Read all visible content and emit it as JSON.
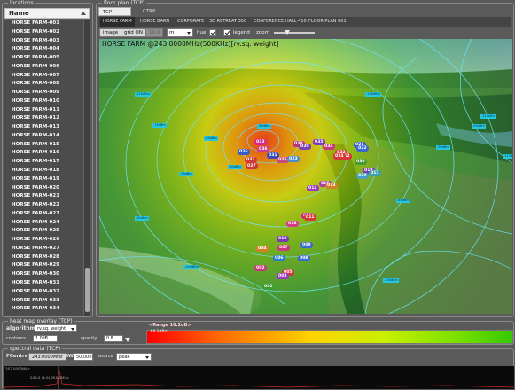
{
  "locations": {
    "title": "locations",
    "column_header": "Name",
    "items": [
      "HORSE FARM-001",
      "HORSE FARM-002",
      "HORSE FARM-003",
      "HORSE FARM-004",
      "HORSE FARM-005",
      "HORSE FARM-006",
      "HORSE FARM-007",
      "HORSE FARM-008",
      "HORSE FARM-009",
      "HORSE FARM-010",
      "HORSE FARM-011",
      "HORSE FARM-012",
      "HORSE FARM-013",
      "HORSE FARM-014",
      "HORSE FARM-015",
      "HORSE FARM-016",
      "HORSE FARM-017",
      "HORSE FARM-018",
      "HORSE FARM-019",
      "HORSE FARM-020",
      "HORSE FARM-021",
      "HORSE FARM-022",
      "HORSE FARM-023",
      "HORSE FARM-024",
      "HORSE FARM-025",
      "HORSE FARM-026",
      "HORSE FARM-027",
      "HORSE FARM-028",
      "HORSE FARM-029",
      "HORSE FARM-030",
      "HORSE FARM-031",
      "HORSE FARM-032",
      "HORSE FARM-033",
      "HORSE FARM-034"
    ]
  },
  "floor_plan": {
    "title": "floor plan (TCP)",
    "view_tabs": [
      "TCP settings...",
      "CTRP chart"
    ],
    "site_tabs": [
      "HORSE FARM",
      "HORSE BARN",
      "CORPORATE",
      "3D RETREAT 300",
      "CONFERENCE HALL 410",
      "FLOOR PLAN 001"
    ],
    "toolbar": {
      "image_label": "image",
      "grid_label": "grid ON",
      "dim_value": "10.0",
      "unit_value": "m",
      "hue_label": "hue",
      "legend_label": "legend",
      "zoom_label": "zoom"
    },
    "map_caption": "HORSE FARM @243.0000MHz(500KHz)[rv.sq. weight]",
    "access_points": [
      {
        "id": "033",
        "color": "#d6288c"
      },
      {
        "id": "028",
        "color": "#c0327c"
      },
      {
        "id": "026",
        "color": "#3a5cc8"
      },
      {
        "id": "036",
        "color": "#d03c8a"
      },
      {
        "id": "020",
        "color": "#7a3fb0"
      },
      {
        "id": "035",
        "color": "#7b3ab8"
      },
      {
        "id": "034",
        "color": "#c8387c"
      },
      {
        "id": "021",
        "color": "#3c5fc0"
      },
      {
        "id": "037",
        "color": "#d23a38"
      },
      {
        "id": "031",
        "color": "#3a4ab8"
      },
      {
        "id": "027",
        "color": "#c83a3a"
      },
      {
        "id": "025",
        "color": "#c84a7a"
      },
      {
        "id": "023",
        "color": "#4a8ad0"
      },
      {
        "id": "032",
        "color": "#e04040"
      },
      {
        "id": "012",
        "color": "#d23a3a"
      },
      {
        "id": "030",
        "color": "#4a9a30"
      },
      {
        "id": "019",
        "color": "#7a3ab0"
      },
      {
        "id": "029",
        "color": "#48a0b8"
      },
      {
        "id": "017",
        "color": "#3aa0b0"
      },
      {
        "id": "018",
        "color": "#d83a8a"
      },
      {
        "id": "016",
        "color": "#c8287c"
      },
      {
        "id": "014",
        "color": "#9a3ac0"
      },
      {
        "id": "015",
        "color": "#b03ab0"
      },
      {
        "id": "013",
        "color": "#d0802a"
      },
      {
        "id": "011",
        "color": "#d23a3a"
      },
      {
        "id": "010",
        "color": "#7a3ab0"
      },
      {
        "id": "009",
        "color": "#3a6ad0"
      },
      {
        "id": "007",
        "color": "#c8387c"
      },
      {
        "id": "004",
        "color": "#d0802a"
      },
      {
        "id": "006",
        "color": "#2a80c8"
      },
      {
        "id": "008",
        "color": "#3a6ad0"
      },
      {
        "id": "005",
        "color": "#d23a3a"
      },
      {
        "id": "002",
        "color": "#c8387c"
      },
      {
        "id": "003",
        "color": "#9a3ac0"
      },
      {
        "id": "001",
        "color": "#3aa030"
      },
      {
        "id": "022",
        "color": "#3a6ad0"
      },
      {
        "id": "024",
        "color": "#d23a3a"
      }
    ],
    "contour_labels": [
      "-54dBm",
      "-60dBm",
      "-65dBm",
      "-70dBm",
      "-75dBm",
      "-80dBm",
      "-85dBm",
      "-90dBm",
      "-95dBm",
      "-100dBm",
      "-105dBm",
      "-110dBm",
      "-115dBm",
      "-120dBm",
      "-125dBm"
    ]
  },
  "heat_overlay": {
    "title": "heat map overlay (TCP)",
    "algorithm_label": "algorithm",
    "algorithm_value": "rv.sq. weight",
    "contours_label": "contours",
    "contours_value": "1.0dB",
    "opacity_label": "opacity",
    "opacity_value": "0.8",
    "range_label": "<Range 18.2dB>",
    "low_value": "-60.1dBm"
  },
  "spectral": {
    "title": "spectral data (TCP)",
    "fcentre_label": "FCentre",
    "fcentre_value": "243.0000MHz",
    "bw_label": "BW",
    "bw_value": "50.000",
    "source_label": "source",
    "source_value": "peak",
    "freq_start": "163.0000MHz",
    "freq_mid": "243.0 (4.0) 250.0MHz"
  }
}
